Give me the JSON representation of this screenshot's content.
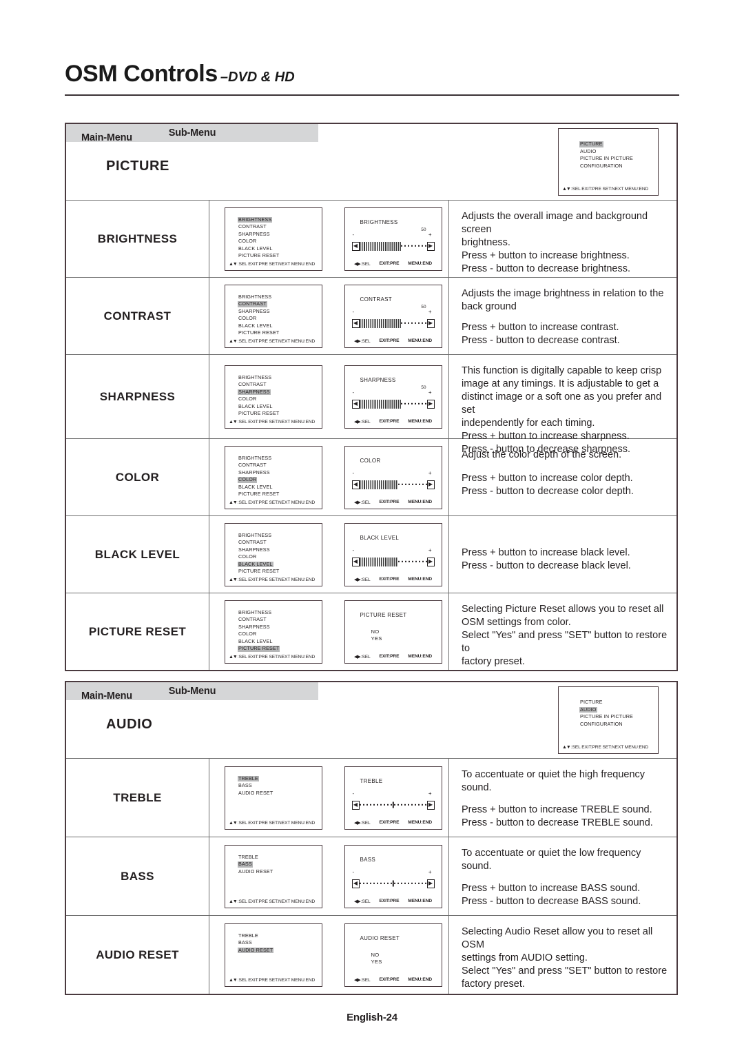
{
  "page": {
    "title_main": "OSM Controls",
    "title_sub": "–DVD & HD",
    "footer": "English-24"
  },
  "labels": {
    "main_menu": "Main-Menu",
    "sub_menu": "Sub-Menu",
    "osd_footer_main": ":SEL EXIT:PRE SET:NEXT MENU:END",
    "osd_footer_adj_sel": ":SEL",
    "osd_footer_adj_exit": "EXIT:PRE",
    "osd_footer_adj_menu": "MENU:END",
    "arrows_updown": "▲▼",
    "arrows_leftright": "◀▶",
    "arrow_left": "◀",
    "arrow_right": "▶"
  },
  "main_menu_items": [
    "PICTURE",
    "AUDIO",
    "PICTURE IN PICTURE",
    "CONFIGURATION"
  ],
  "sections": [
    {
      "name": "PICTURE",
      "selected_main": "PICTURE",
      "submenu_items": [
        "BRIGHTNESS",
        "CONTRAST",
        "SHARPNESS",
        "COLOR",
        "BLACK LEVEL",
        "PICTURE RESET"
      ],
      "rows": [
        {
          "label": "BRIGHTNESS",
          "selected": "BRIGHTNESS",
          "adj": {
            "title": "BRIGHTNESS",
            "kind": "slider",
            "value": "50",
            "minus": "-",
            "plus": "+",
            "fill_pct": 62,
            "center_mark": false
          },
          "desc": [
            "Adjusts the overall image and background screen",
            "brightness.",
            "",
            "Press + button to increase brightness.",
            "Press - button to decrease brightness."
          ]
        },
        {
          "label": "CONTRAST",
          "selected": "CONTRAST",
          "adj": {
            "title": "CONTRAST",
            "kind": "slider",
            "value": "50",
            "minus": "-",
            "plus": "+",
            "fill_pct": 62,
            "center_mark": false
          },
          "desc": [
            "Adjusts the image brightness in relation to the",
            "back ground",
            "",
            "Press + button to increase contrast.",
            "Press - button to decrease contrast."
          ]
        },
        {
          "label": "SHARPNESS",
          "selected": "SHARPNESS",
          "adj": {
            "title": "SHARPNESS",
            "kind": "slider",
            "value": "50",
            "minus": "-",
            "plus": "+",
            "fill_pct": 62,
            "center_mark": false
          },
          "desc": [
            "This function is digitally capable to keep crisp",
            "image at any timings.  It is adjustable to get a",
            "distinct image or a soft one as you prefer and set",
            "independently for each timing.",
            "Press + button to increase sharpness.",
            "Press - button to decrease sharpness."
          ]
        },
        {
          "label": "COLOR",
          "selected": "COLOR",
          "adj": {
            "title": "COLOR",
            "kind": "slider",
            "value": "",
            "minus": "-",
            "plus": "+",
            "fill_pct": 58,
            "center_mark": false
          },
          "desc": [
            "Adjust the color depth  of the screen.",
            "",
            "Press  + button to increase color depth.",
            "Press - button to decrease color depth."
          ]
        },
        {
          "label": "BLACK LEVEL",
          "selected": "BLACK LEVEL",
          "adj": {
            "title": "BLACK LEVEL",
            "kind": "slider",
            "value": "",
            "minus": "-",
            "plus": "+",
            "fill_pct": 58,
            "center_mark": false
          },
          "desc": [
            "",
            "",
            "Press + button to increase black level.",
            "Press - button to decrease black level."
          ]
        },
        {
          "label": "PICTURE RESET",
          "selected": "PICTURE RESET",
          "adj": {
            "title": "PICTURE RESET",
            "kind": "options",
            "options": [
              "NO",
              "YES"
            ]
          },
          "desc": [
            "Selecting Picture Reset allows you to reset all",
            "OSM settings from color.",
            "",
            "Select \"Yes\" and press \"SET\" button to restore to",
            "factory preset."
          ]
        }
      ]
    },
    {
      "name": "AUDIO",
      "selected_main": "AUDIO",
      "submenu_items": [
        "TREBLE",
        "BASS",
        "AUDIO RESET"
      ],
      "rows": [
        {
          "label": "TREBLE",
          "selected": "TREBLE",
          "adj": {
            "title": "TREBLE",
            "kind": "slider",
            "value": "",
            "minus": "-",
            "plus": "+",
            "fill_pct": 0,
            "center_mark": true
          },
          "desc": [
            "To accentuate or quiet the high frequency sound.",
            "",
            "Press + button to increase TREBLE sound.",
            "Press - button to decrease TREBLE sound."
          ]
        },
        {
          "label": "BASS",
          "selected": "BASS",
          "adj": {
            "title": "BASS",
            "kind": "slider",
            "value": "",
            "minus": "-",
            "plus": "+",
            "fill_pct": 0,
            "center_mark": true
          },
          "desc": [
            "To accentuate or quiet the low frequency sound.",
            "",
            "Press + button to increase BASS sound.",
            "Press - button to decrease BASS sound."
          ]
        },
        {
          "label": "AUDIO RESET",
          "selected": "AUDIO RESET",
          "adj": {
            "title": "AUDIO RESET",
            "kind": "options",
            "options": [
              "NO",
              "YES"
            ]
          },
          "desc": [
            "Selecting Audio Reset allow you to reset all OSM",
            "settings from AUDIO setting.",
            "",
            "Select \"Yes\" and press \"SET\" button to restore",
            "factory preset."
          ]
        }
      ]
    }
  ]
}
